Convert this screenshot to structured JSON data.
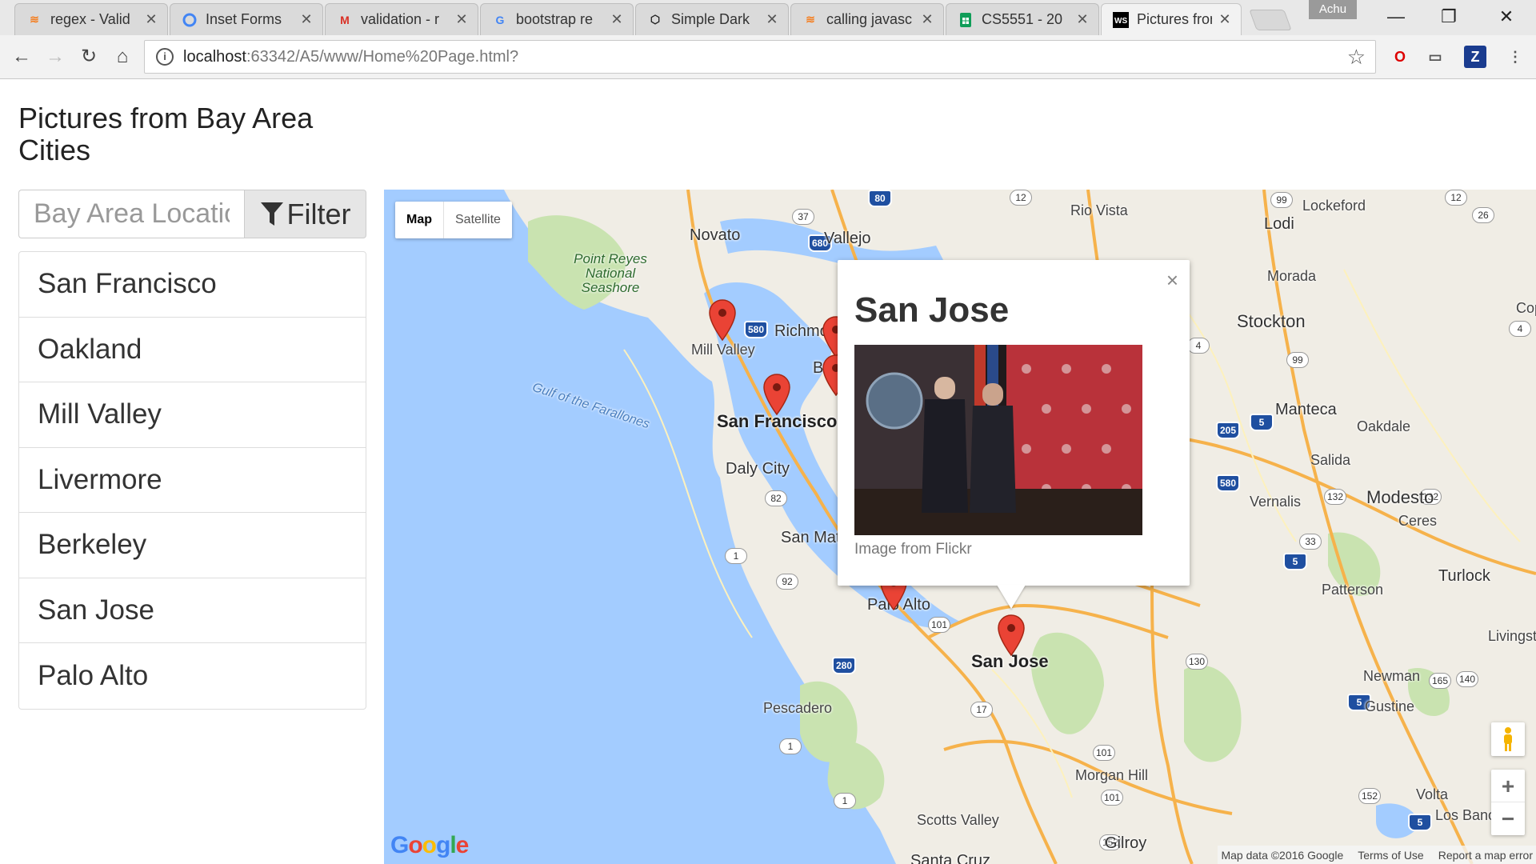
{
  "browser": {
    "tabs": [
      {
        "title": "regex - Valid",
        "favicon": "stackoverflow-icon",
        "color": "#f48024"
      },
      {
        "title": "Inset Forms",
        "favicon": "circle-icon",
        "color": "#4285f4"
      },
      {
        "title": "validation - r",
        "favicon": "gmail-icon",
        "color": "#d93025"
      },
      {
        "title": "bootstrap re",
        "favicon": "google-icon",
        "color": "#4285f4"
      },
      {
        "title": "Simple Dark",
        "favicon": "codepen-icon",
        "color": "#222222"
      },
      {
        "title": "calling javasc",
        "favicon": "stackoverflow-icon",
        "color": "#f48024"
      },
      {
        "title": "CS5551 - 20",
        "favicon": "sheets-icon",
        "color": "#0f9d58"
      },
      {
        "title": "Pictures fron",
        "favicon": "webstorm-icon",
        "color": "#000000"
      }
    ],
    "profile_name": "Achu",
    "url_host": "localhost",
    "url_rest": ":63342/A5/www/Home%20Page.html?"
  },
  "page": {
    "title": "Pictures from Bay Area Cities",
    "search_placeholder": "Bay Area Location",
    "filter_label": "Filter",
    "cities": [
      "San Francisco",
      "Oakland",
      "Mill Valley",
      "Livermore",
      "Berkeley",
      "San Jose",
      "Palo Alto"
    ]
  },
  "map": {
    "map_type_options": [
      "Map",
      "Satellite"
    ],
    "selected_map_type": "Map",
    "infowindow": {
      "title": "San Jose",
      "caption": "Image from Flickr",
      "close_symbol": "×"
    },
    "labels": {
      "novato": "Novato",
      "vallejo": "Vallejo",
      "rio_vista": "Rio Vista",
      "lockeford": "Lockeford",
      "lodi": "Lodi",
      "morada": "Morada",
      "stockton": "Stockton",
      "point_reyes": "Point Reyes National Seashore",
      "gulf": "Gulf of the Farallones",
      "mill_valley": "Mill Valley",
      "richmond": "Richmon",
      "berkeley": "Be",
      "san_francisco": "San Francisco",
      "daly_city": "Daly City",
      "san_mateo": "San Mat",
      "palo_alto": "Palo Alto",
      "san_jose": "San Jose",
      "pescadero": "Pescadero",
      "morgan_hill": "Morgan Hill",
      "scotts_valley": "Scotts Valley",
      "gilroy": "Gilroy",
      "santa_cruz": "Santa Cruz",
      "manteca": "Manteca",
      "oakdale": "Oakdale",
      "salida": "Salida",
      "vernalis": "Vernalis",
      "modesto": "Modesto",
      "ceres": "Ceres",
      "turlock": "Turlock",
      "patterson": "Patterson",
      "newman": "Newman",
      "gustine": "Gustine",
      "volta": "Volta",
      "los_banos": "Los Banos",
      "livingston": "Livingst",
      "cop": "Cop"
    },
    "attribution": {
      "map_data": "Map data ©2016 Google",
      "terms": "Terms of Use",
      "report": "Report a map error"
    },
    "google_logo": "Google",
    "colors": {
      "water": "#a3ccff",
      "land": "#f0ede5",
      "park": "#c9e3b0",
      "road_major": "#f6b24b",
      "marker": "#ea4335"
    }
  }
}
